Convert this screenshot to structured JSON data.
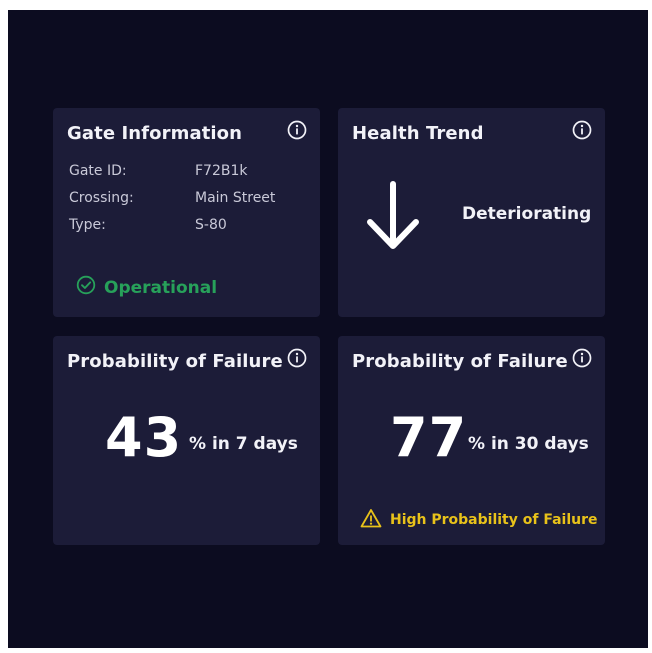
{
  "gate_info": {
    "title": "Gate Information",
    "rows": [
      {
        "label": "Gate ID:",
        "value": "F72B1k"
      },
      {
        "label": "Crossing:",
        "value": "Main Street"
      },
      {
        "label": "Type:",
        "value": "S-80"
      }
    ],
    "status": "Operational",
    "status_icon": "check-circle-icon",
    "status_color": "#27a15a"
  },
  "health_trend": {
    "title": "Health Trend",
    "icon": "arrow-down-icon",
    "value": "Deteriorating"
  },
  "failure_7": {
    "title": "Probability of Failure",
    "value": "43",
    "suffix": "% in 7 days"
  },
  "failure_30": {
    "title": "Probability of Failure",
    "value": "77",
    "suffix": "% in 30 days",
    "warning": "High Probability of Failure",
    "warning_icon": "warning-triangle-icon",
    "warning_color": "#e8c21a"
  },
  "colors": {
    "background": "#0c0c20",
    "card": "#1c1c38"
  }
}
